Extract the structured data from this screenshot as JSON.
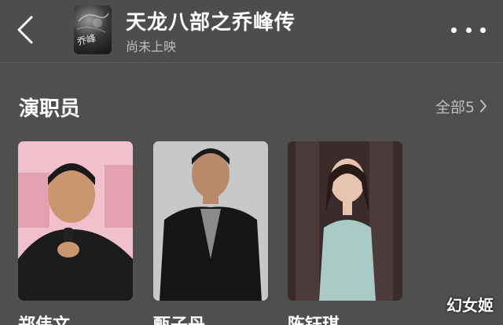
{
  "header": {
    "title": "天龙八部之乔峰传",
    "subtitle": "尚未上映",
    "poster_text": "乔峰"
  },
  "section": {
    "title": "演职员",
    "see_all_label": "全部5"
  },
  "cast": [
    {
      "name": "郑伟文"
    },
    {
      "name": "甄子丹"
    },
    {
      "name": "陈钰琪"
    }
  ],
  "watermark": "幻女姬",
  "icons": {
    "back": "chevron-left-icon",
    "more": "more-horizontal-icon",
    "see_all": "chevron-right-icon"
  },
  "colors": {
    "background": "#4f4f4f",
    "text_primary": "#ffffff",
    "text_secondary": "#bdbdbd"
  }
}
